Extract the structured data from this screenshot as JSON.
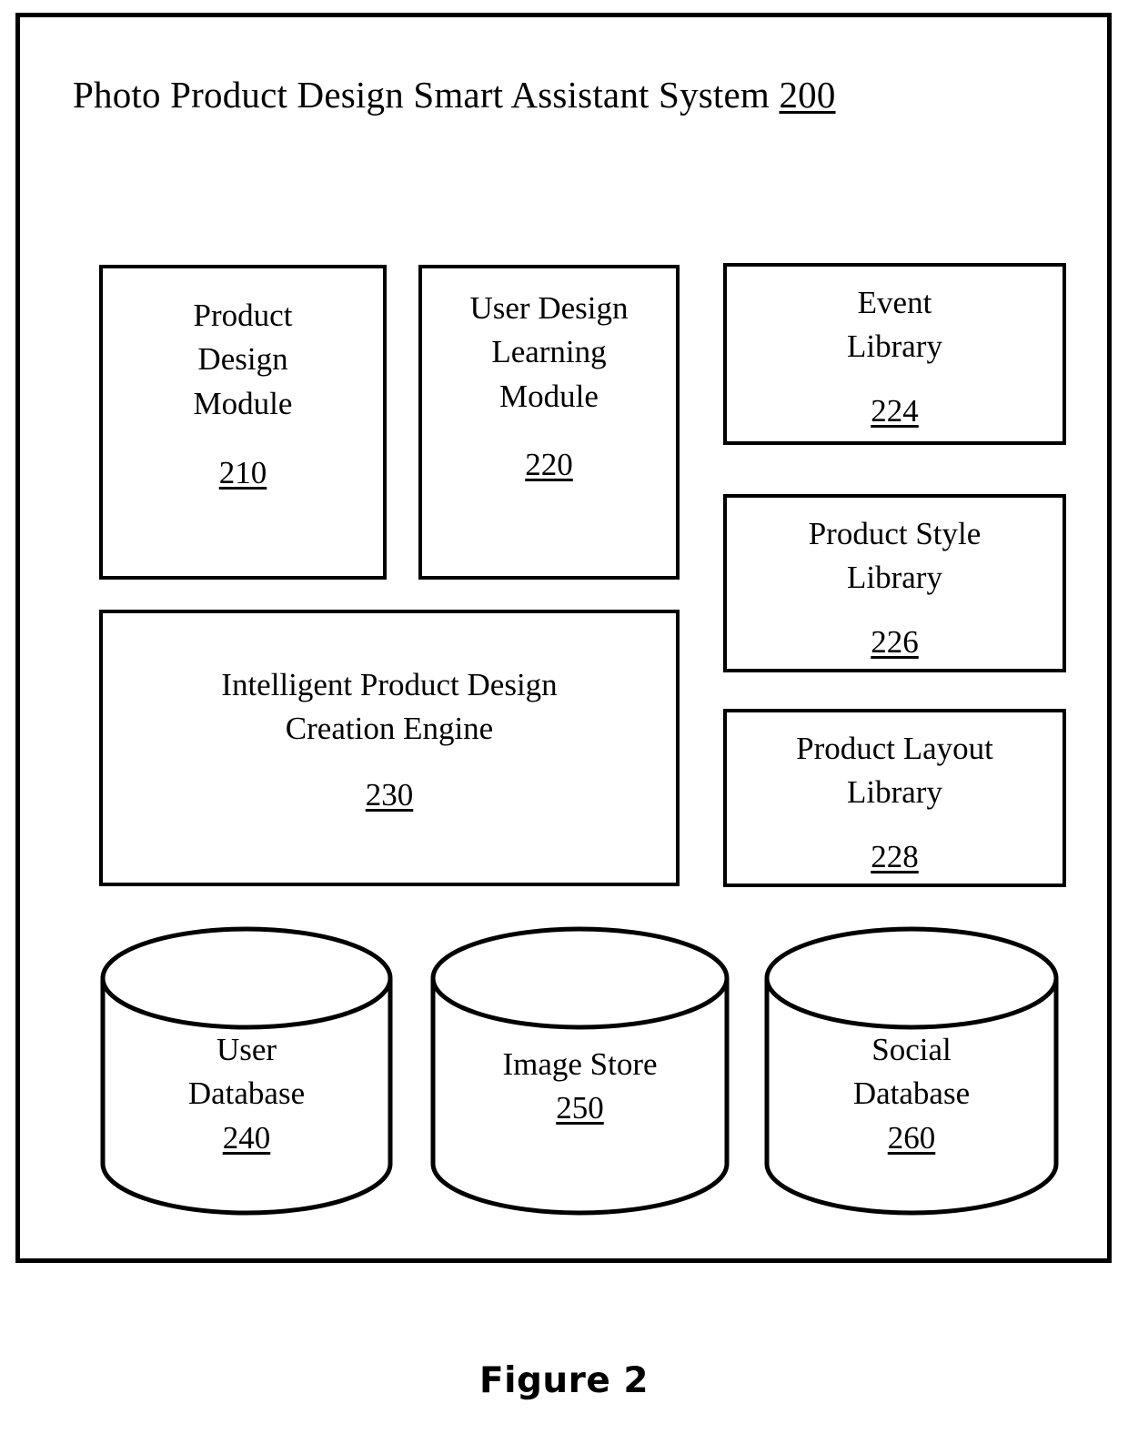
{
  "figure": {
    "caption": "Figure 2",
    "title_text": "Photo Product Design Smart Assistant System",
    "title_ref": "200"
  },
  "colors": {
    "stroke": "#000000",
    "background": "#ffffff"
  },
  "modules": {
    "product_design": {
      "label": "Product\nDesign\nModule",
      "ref": "210"
    },
    "user_design_learning": {
      "label": "User Design\nLearning\nModule",
      "ref": "220"
    },
    "creation_engine": {
      "label": "Intelligent Product Design\nCreation Engine",
      "ref": "230"
    }
  },
  "libraries": {
    "event": {
      "label": "Event\nLibrary",
      "ref": "224"
    },
    "product_style": {
      "label": "Product Style\nLibrary",
      "ref": "226"
    },
    "product_layout": {
      "label": "Product Layout\nLibrary",
      "ref": "228"
    }
  },
  "datastores": {
    "user_database": {
      "label": "User\nDatabase",
      "ref": "240"
    },
    "image_store": {
      "label": "Image Store",
      "ref": "250"
    },
    "social_database": {
      "label": "Social\nDatabase",
      "ref": "260"
    }
  }
}
